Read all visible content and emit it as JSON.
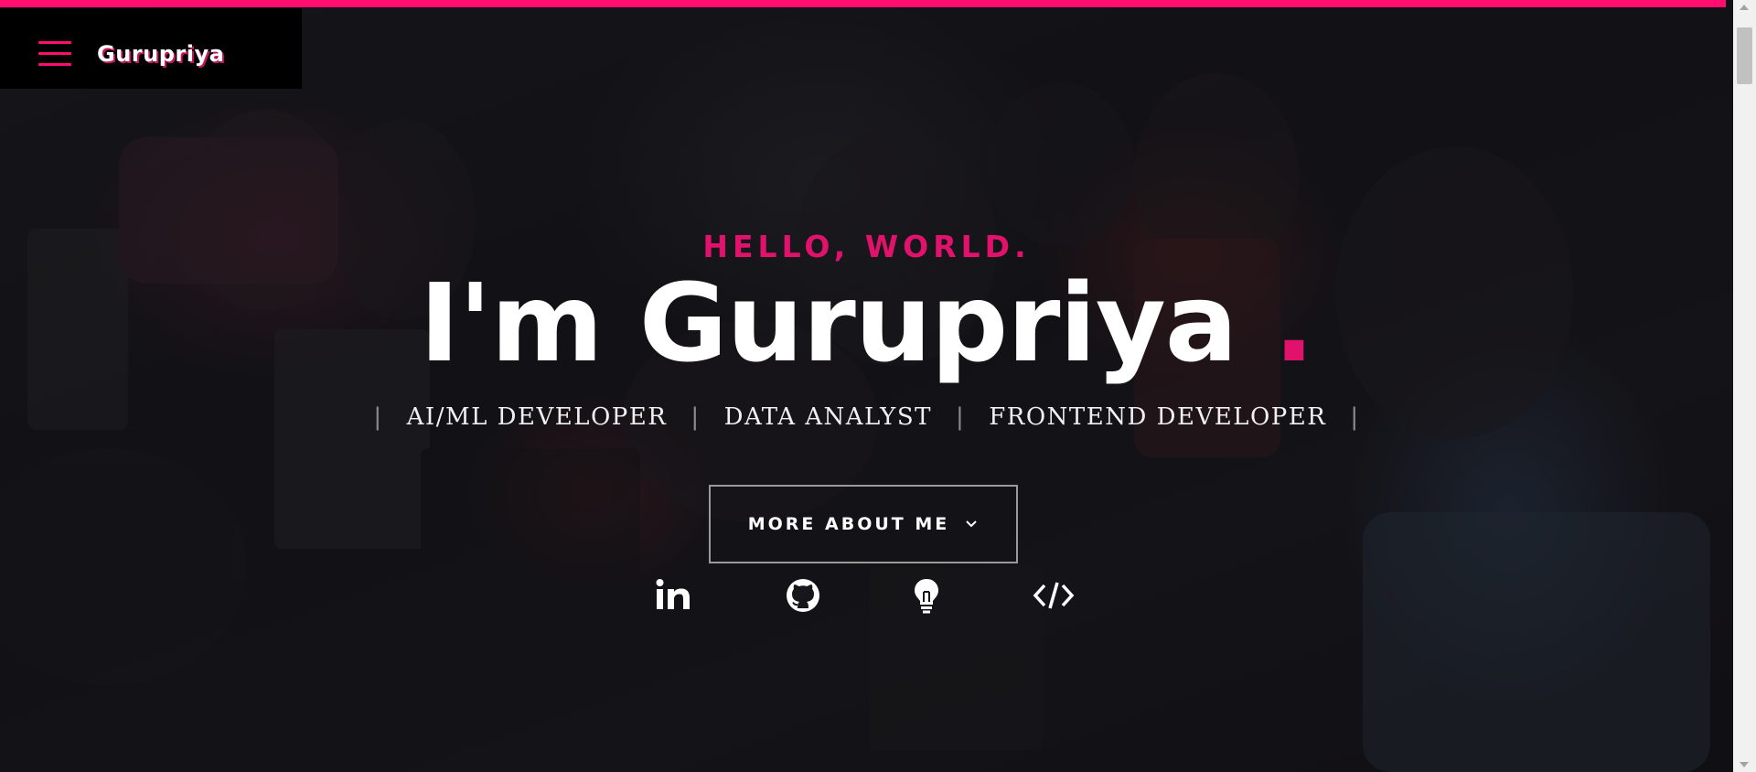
{
  "brand": {
    "name": "Gurupriya"
  },
  "hero": {
    "greeting": "HELLO, WORLD.",
    "name_prefix": "I'm Gurupriya ",
    "name_dot": ".",
    "roles": [
      "AI/ML DEVELOPER",
      "DATA ANALYST",
      "FRONTEND DEVELOPER"
    ],
    "separator": "|",
    "cta_label": "MORE ABOUT ME"
  },
  "social": [
    {
      "icon": "linkedin-icon"
    },
    {
      "icon": "github-icon"
    },
    {
      "icon": "lightbulb-icon"
    },
    {
      "icon": "code-icon"
    }
  ],
  "colors": {
    "accent": "#ff0d6f",
    "accent_text": "#e0126b",
    "background": "#17161b",
    "text": "#ffffff"
  }
}
